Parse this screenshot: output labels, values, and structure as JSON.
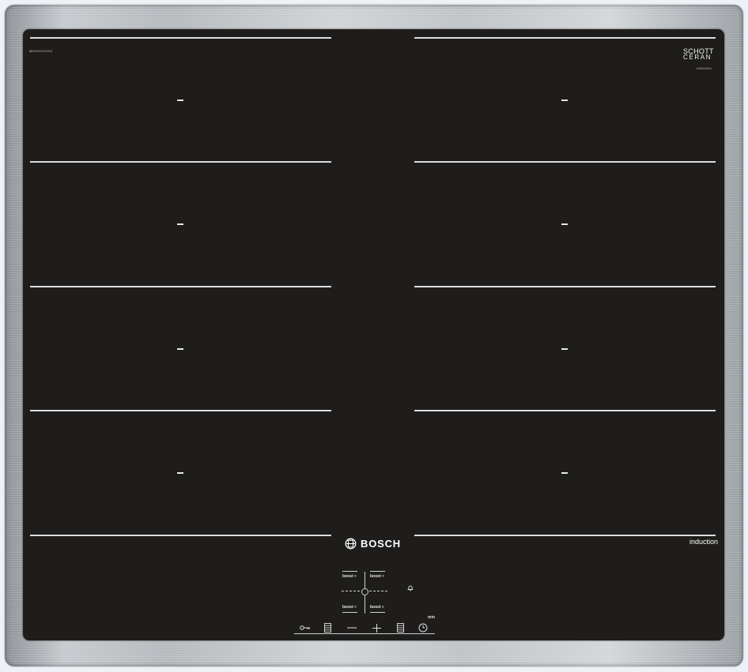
{
  "serial_left": "MXXXXXXXXX",
  "schott_ceran": {
    "line1": "SCHOTT",
    "line2": "CERAN",
    "serial": "XXXXXXXX"
  },
  "brand": "BOSCH",
  "induction_label": "induction",
  "zones": [
    {
      "id": "left-1"
    },
    {
      "id": "left-2"
    },
    {
      "id": "left-3"
    },
    {
      "id": "left-4"
    },
    {
      "id": "right-1"
    },
    {
      "id": "right-2"
    },
    {
      "id": "right-3"
    },
    {
      "id": "right-4"
    }
  ],
  "boost": {
    "label": "boost",
    "symbol": "≈"
  },
  "controls": [
    {
      "name": "child-lock",
      "icon": "key-icon"
    },
    {
      "name": "zone-select-left",
      "icon": "zone-select-icon"
    },
    {
      "name": "minus",
      "icon": "minus-icon"
    },
    {
      "name": "plus",
      "icon": "plus-icon"
    },
    {
      "name": "zone-select-right",
      "icon": "zone-select-icon"
    },
    {
      "name": "timer",
      "icon": "clock-icon"
    }
  ],
  "timer_unit": "min",
  "colors": {
    "glass": "#1e1d1b",
    "frame": "#c3c7cb",
    "marks": "#dcdcdc"
  }
}
